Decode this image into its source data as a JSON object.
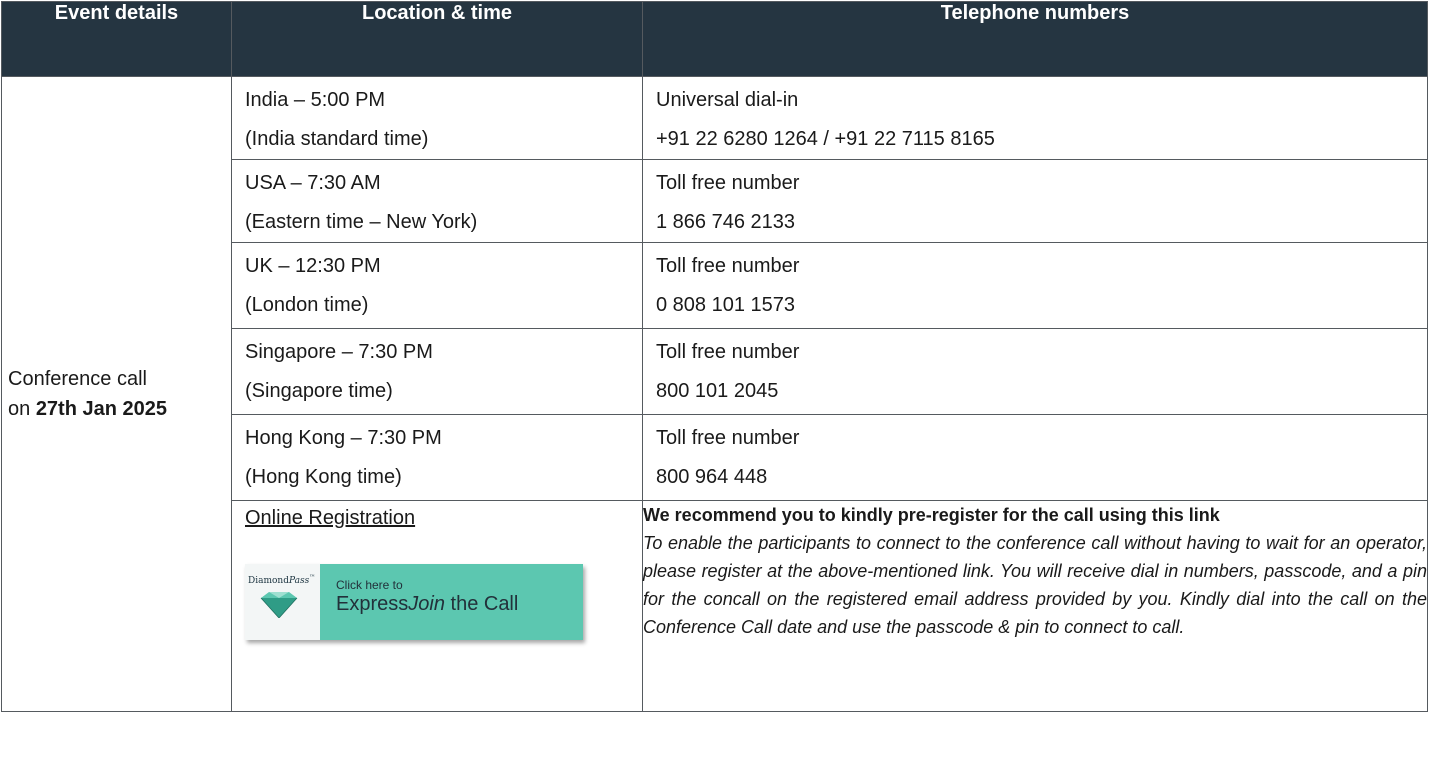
{
  "header": {
    "col1": "Event details",
    "col2": "Location & time",
    "col3": "Telephone numbers"
  },
  "event": {
    "line1": "Conference call",
    "on": "on",
    "date": "27th Jan 2025"
  },
  "rows": [
    {
      "loc": "India – 5:00 PM",
      "time": "(India standard time)",
      "type": "Universal dial-in",
      "number": "+91 22 6280 1264 / +91 22 7115 8165"
    },
    {
      "loc": "USA – 7:30 AM",
      "time": "(Eastern time – New York)",
      "type": "Toll free number",
      "number": "1 866 746 2133"
    },
    {
      "loc": "UK – 12:30 PM",
      "time": "(London time)",
      "type": "Toll free number",
      "number": "0 808 101 1573"
    },
    {
      "loc": "Singapore – 7:30 PM",
      "time": "(Singapore time)",
      "type": "Toll free number",
      "number": "800 101 2045"
    },
    {
      "loc": "Hong Kong – 7:30 PM",
      "time": "(Hong Kong time)",
      "type": "Toll free number",
      "number": "800 964 448"
    }
  ],
  "registration": {
    "link_label": "Online Registration",
    "banner_brand": "DiamondPass™",
    "banner_brand_a": "Diamond",
    "banner_brand_b": "Pass",
    "banner_brand_tm": "™",
    "banner_small": "Click here to",
    "banner_big_a": "Express",
    "banner_big_b": "Join",
    "banner_big_c": " the Call",
    "recommend": "We recommend you to kindly pre-register for the call using this link",
    "details": "To enable the participants to connect to the conference call without having to wait for an operator, please register at the above-mentioned link. You will receive dial in numbers, passcode, and a pin for the concall on the registered email address provided by you. Kindly dial into the call on the Conference Call date and use the passcode & pin to connect to call."
  },
  "colors": {
    "header_bg": "#253541",
    "banner_green": "#5cc7b0"
  }
}
